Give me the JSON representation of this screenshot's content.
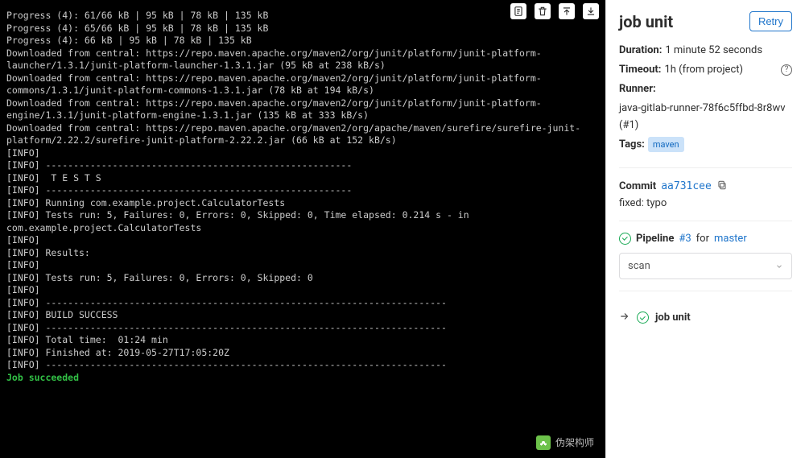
{
  "terminal": {
    "toolbar_icons": [
      "raw-icon",
      "trash-icon",
      "scroll-top-icon",
      "scroll-bottom-icon"
    ],
    "lines": [
      "Progress (4): 61/66 kB | 95 kB | 78 kB | 135 kB",
      "Progress (4): 65/66 kB | 95 kB | 78 kB | 135 kB",
      "Progress (4): 66 kB | 95 kB | 78 kB | 135 kB",
      "",
      "Downloaded from central: https://repo.maven.apache.org/maven2/org/junit/platform/junit-platform-",
      "launcher/1.3.1/junit-platform-launcher-1.3.1.jar (95 kB at 238 kB/s)",
      "Downloaded from central: https://repo.maven.apache.org/maven2/org/junit/platform/junit-platform-",
      "commons/1.3.1/junit-platform-commons-1.3.1.jar (78 kB at 194 kB/s)",
      "Downloaded from central: https://repo.maven.apache.org/maven2/org/junit/platform/junit-platform-",
      "engine/1.3.1/junit-platform-engine-1.3.1.jar (135 kB at 333 kB/s)",
      "Downloaded from central: https://repo.maven.apache.org/maven2/org/apache/maven/surefire/surefire-junit-",
      "platform/2.22.2/surefire-junit-platform-2.22.2.jar (66 kB at 152 kB/s)",
      "[INFO]",
      "[INFO] -------------------------------------------------------",
      "[INFO]  T E S T S",
      "[INFO] -------------------------------------------------------",
      "[INFO] Running com.example.project.CalculatorTests",
      "[INFO] Tests run: 5, Failures: 0, Errors: 0, Skipped: 0, Time elapsed: 0.214 s - in",
      "com.example.project.CalculatorTests",
      "[INFO]",
      "[INFO] Results:",
      "[INFO]",
      "[INFO] Tests run: 5, Failures: 0, Errors: 0, Skipped: 0",
      "[INFO]",
      "[INFO] ------------------------------------------------------------------------",
      "[INFO] BUILD SUCCESS",
      "[INFO] ------------------------------------------------------------------------",
      "[INFO] Total time:  01:24 min",
      "[INFO] Finished at: 2019-05-27T17:05:20Z",
      "[INFO] ------------------------------------------------------------------------"
    ],
    "success_line": "Job succeeded"
  },
  "side": {
    "title": "job unit",
    "retry_label": "Retry",
    "meta": {
      "duration_label": "Duration:",
      "duration_value": "1 minute 52 seconds",
      "timeout_label": "Timeout:",
      "timeout_value": "1h (from project)",
      "runner_label": "Runner:",
      "runner_value": "java-gitlab-runner-78f6c5ffbd-8r8wv (#1)",
      "tags_label": "Tags:",
      "tag_value": "maven"
    },
    "commit": {
      "label": "Commit",
      "sha": "aa731cee",
      "message": "fixed: typo"
    },
    "pipeline": {
      "label": "Pipeline",
      "id": "#3",
      "for": "for",
      "branch": "master",
      "stage_selected": "scan"
    },
    "job": {
      "name": "job unit"
    }
  },
  "watermark": "伪架构师"
}
